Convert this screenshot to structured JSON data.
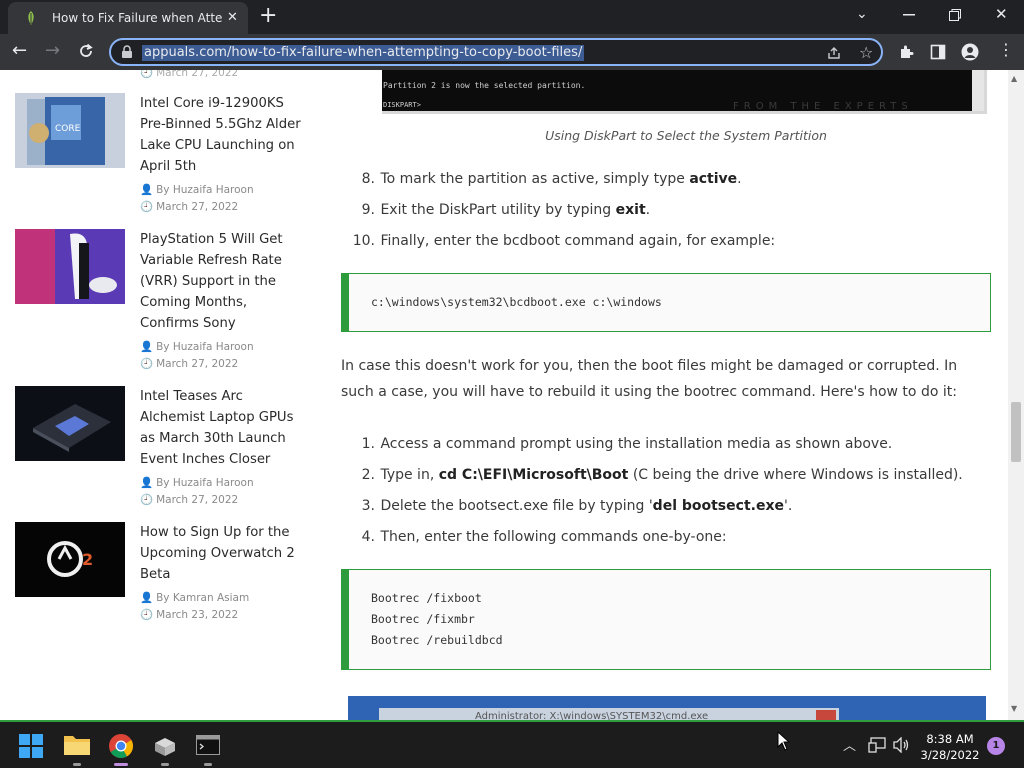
{
  "browser": {
    "tab_title": "How to Fix Failure when Attempting to Copy Boot Files",
    "url": "appuals.com/how-to-fix-failure-when-attempting-to-copy-boot-files/",
    "accent": "#8ab4f8"
  },
  "sidebar": {
    "top_cut_date": "March 27, 2022",
    "items": [
      {
        "title": "Intel Core i9-12900KS Pre-Binned 5.5Ghz Alder Lake CPU Launching on April 5th",
        "author": "By Huzaifa Haroon",
        "date": "March 27, 2022"
      },
      {
        "title": "PlayStation 5 Will Get Variable Refresh Rate (VRR) Support in the Coming Months, Confirms Sony",
        "author": "By Huzaifa Haroon",
        "date": "March 27, 2022"
      },
      {
        "title": "Intel Teases Arc Alchemist Laptop GPUs as March 30th Launch Event Inches Closer",
        "author": "By Huzaifa Haroon",
        "date": "March 27, 2022"
      },
      {
        "title": "How to Sign Up for the Upcoming Overwatch 2 Beta",
        "author": "By Kamran Asiam",
        "date": "March 23, 2022"
      }
    ]
  },
  "article": {
    "console_line1": "Partition 2 is now the selected partition.",
    "console_prompt": "DISKPART>",
    "watermark": "FROM THE EXPERTS",
    "caption": "Using DiskPart to Select the System Partition",
    "steps_a": [
      {
        "n": "8.",
        "pre": "To mark the partition as active, simply type ",
        "bold": "active",
        "post": "."
      },
      {
        "n": "9.",
        "pre": "Exit the DiskPart utility by typing ",
        "bold": "exit",
        "post": "."
      },
      {
        "n": "10.",
        "pre": "Finally, enter the bcdboot command again, for example:",
        "bold": "",
        "post": ""
      }
    ],
    "code1": "c:\\windows\\system32\\bcdboot.exe c:\\windows",
    "paragraph": "In case this doesn't work for you, then the boot files might be damaged or corrupted. In such a case, you will have to rebuild it using the bootrec command. Here's how to do it:",
    "steps_b": [
      {
        "n": "1.",
        "pre": "Access a command prompt using the installation media as shown above.",
        "bold": "",
        "post": ""
      },
      {
        "n": "2.",
        "pre": "Type in, ",
        "bold": "cd C:\\EFI\\Microsoft\\Boot",
        "post": " (C being the drive where Windows is installed)."
      },
      {
        "n": "3.",
        "pre": "Delete the bootsect.exe file by typing '",
        "bold": "del bootsect.exe",
        "post": "'."
      },
      {
        "n": "4.",
        "pre": "Then, enter the following commands one-by-one:",
        "bold": "",
        "post": ""
      }
    ],
    "code2": [
      "Bootrec /fixboot",
      "Bootrec /fixmbr",
      "Bootrec /rebuildbcd"
    ],
    "next_image_title": "Administrator: X:\\windows\\SYSTEM32\\cmd.exe"
  },
  "taskbar": {
    "time": "8:38 AM",
    "date": "3/28/2022",
    "notifications": "1"
  }
}
